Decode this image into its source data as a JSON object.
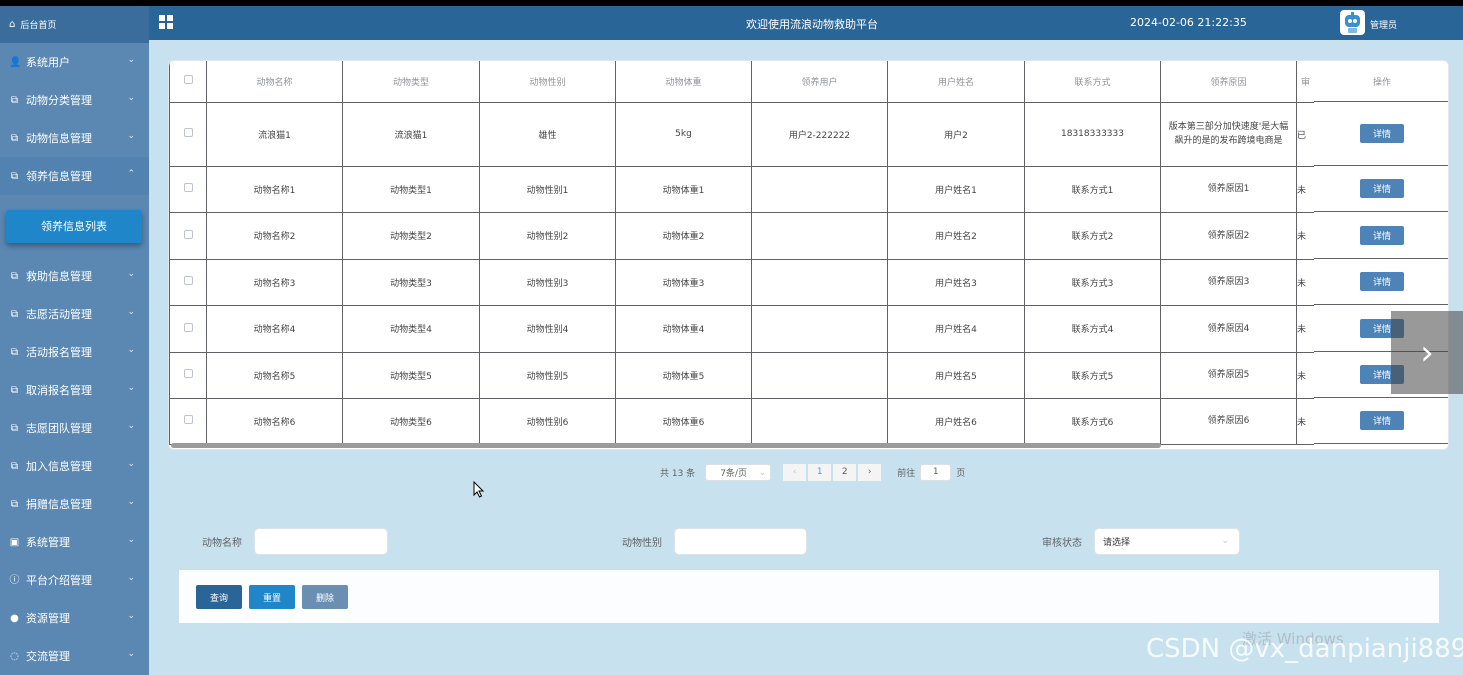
{
  "header": {
    "title": "欢迎使用流浪动物救助平台",
    "datetime": "2024-02-06 21:22:35",
    "user": "管理员"
  },
  "sidebar": {
    "home": "后台首页",
    "items": [
      {
        "label": "系统用户",
        "icon": "user-icon",
        "glyph": "👤"
      },
      {
        "label": "动物分类管理",
        "icon": "edit-icon",
        "glyph": "⧉"
      },
      {
        "label": "动物信息管理",
        "icon": "edit-icon",
        "glyph": "⧉"
      },
      {
        "label": "领养信息管理",
        "icon": "edit-icon",
        "glyph": "⧉",
        "open": true
      },
      {
        "label": "救助信息管理",
        "icon": "edit-icon",
        "glyph": "⧉"
      },
      {
        "label": "志愿活动管理",
        "icon": "edit-icon",
        "glyph": "⧉"
      },
      {
        "label": "活动报名管理",
        "icon": "edit-icon",
        "glyph": "⧉"
      },
      {
        "label": "取消报名管理",
        "icon": "edit-icon",
        "glyph": "⧉"
      },
      {
        "label": "志愿团队管理",
        "icon": "edit-icon",
        "glyph": "⧉"
      },
      {
        "label": "加入信息管理",
        "icon": "edit-icon",
        "glyph": "⧉"
      },
      {
        "label": "捐赠信息管理",
        "icon": "edit-icon",
        "glyph": "⧉"
      },
      {
        "label": "系统管理",
        "icon": "picture-icon",
        "glyph": "▣"
      },
      {
        "label": "平台介绍管理",
        "icon": "info-icon",
        "glyph": "ⓘ"
      },
      {
        "label": "资源管理",
        "icon": "location-icon",
        "glyph": "●"
      },
      {
        "label": "交流管理",
        "icon": "chat-icon",
        "glyph": "◌"
      }
    ],
    "subitem": "领养信息列表"
  },
  "table": {
    "columns": [
      "动物名称",
      "动物类型",
      "动物性别",
      "动物体重",
      "领养用户",
      "用户姓名",
      "联系方式",
      "领养原因",
      "审",
      "操作"
    ],
    "rows": [
      [
        "流浪猫1",
        "流浪猫1",
        "雄性",
        "5kg",
        "用户2-222222",
        "用户2",
        "18318333333",
        "版本第三部分加快速度'是大幅飙升的是的发布跨境电商是",
        "已"
      ],
      [
        "动物名称1",
        "动物类型1",
        "动物性别1",
        "动物体重1",
        "",
        "用户姓名1",
        "联系方式1",
        "领养原因1",
        "未"
      ],
      [
        "动物名称2",
        "动物类型2",
        "动物性别2",
        "动物体重2",
        "",
        "用户姓名2",
        "联系方式2",
        "领养原因2",
        "未"
      ],
      [
        "动物名称3",
        "动物类型3",
        "动物性别3",
        "动物体重3",
        "",
        "用户姓名3",
        "联系方式3",
        "领养原因3",
        "未"
      ],
      [
        "动物名称4",
        "动物类型4",
        "动物性别4",
        "动物体重4",
        "",
        "用户姓名4",
        "联系方式4",
        "领养原因4",
        "未"
      ],
      [
        "动物名称5",
        "动物类型5",
        "动物性别5",
        "动物体重5",
        "",
        "用户姓名5",
        "联系方式5",
        "领养原因5",
        "未"
      ],
      [
        "动物名称6",
        "动物类型6",
        "动物性别6",
        "动物体重6",
        "",
        "用户姓名6",
        "联系方式6",
        "领养原因6",
        "未"
      ]
    ],
    "detail_label": "详情"
  },
  "pager": {
    "total": "共 13 条",
    "page_size": "7条/页",
    "pages": [
      "1",
      "2"
    ],
    "goto_prefix": "前往",
    "goto_value": "1",
    "goto_suffix": "页"
  },
  "filters": {
    "name_label": "动物名称",
    "gender_label": "动物性别",
    "status_label": "审核状态",
    "status_placeholder": "请选择"
  },
  "actions": {
    "query": "查询",
    "reset": "重置",
    "delete": "删除"
  },
  "watermarks": {
    "windows": "激活 Windows",
    "csdn": "CSDN @vx_danpianji889"
  },
  "colors": {
    "sidebar": "#5a88b3",
    "topbar": "#2a6597",
    "page_bg": "#c7e2ee",
    "query_btn": "#2a6597",
    "reset_btn": "#1f86c9",
    "delete_btn": "#6b8fb3"
  }
}
